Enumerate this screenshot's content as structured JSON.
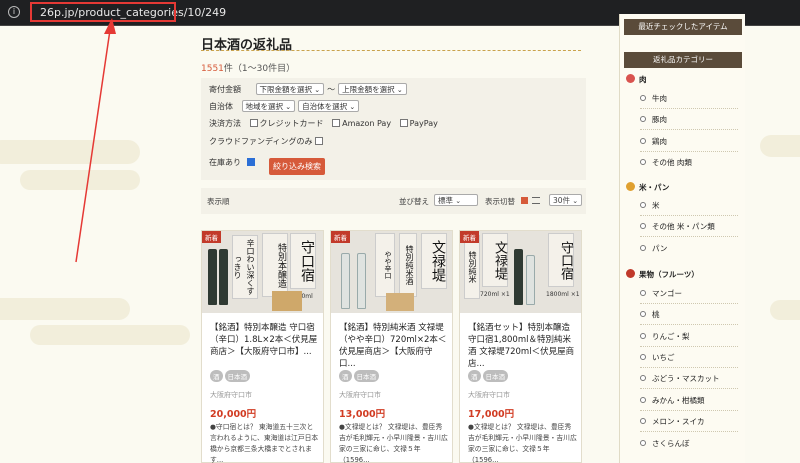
{
  "browser": {
    "url": "26p.jp/product_categories/10/249"
  },
  "main": {
    "title": "日本酒の返礼品",
    "count_num": "1551",
    "count_rest": "件（1～30件目）",
    "filter": {
      "amount_label": "寄付金額",
      "amount_min": "下限金額を選択",
      "tilde": "～",
      "amount_max": "上限金額を選択",
      "region_label": "自治体",
      "region_select": "地域を選択",
      "city_select": "自治体を選択",
      "payment_label": "決済方法",
      "pay_credit": "クレジットカード",
      "pay_amazon": "Amazon Pay",
      "pay_paypay": "PayPay",
      "crowd_label": "クラウドファンディングのみ",
      "stock_label": "在庫あり",
      "search_button": "絞り込み検索"
    },
    "sortbar": {
      "display_order": "表示順",
      "sort_label": "並び替え",
      "sort_value": "標準",
      "view_label": "表示切替",
      "per_page": "30件"
    },
    "cards": [
      {
        "badge": "新着",
        "title": "【銘酒】特別本醸造 守口宿（辛口）1.8L×2本＜伏見屋商店＞【大阪府守口市】...",
        "tags": [
          "酒",
          "日本酒"
        ],
        "location": "大阪府守口市",
        "price": "20,000円",
        "desc": "●守口宿とは？ 東海道五十三次と言われるように、東海道は江戸日本橋から京都三条大橋までとされます..."
      },
      {
        "badge": "新着",
        "title": "【銘酒】特別純米酒 文禄堤（やや辛口）720ml×2本＜伏見屋商店＞【大阪府守口...",
        "tags": [
          "酒",
          "日本酒"
        ],
        "location": "大阪府守口市",
        "price": "13,000円",
        "desc": "●文禄堤とは？ 文禄堤は、豊臣秀吉が毛利輝元・小早川隆景・吉川広家の三家に命じ、文禄５年（1596..."
      },
      {
        "badge": "新着",
        "title": "【銘酒セット】特別本醸造 守口宿1,800ml＆特別純米酒 文禄堤720ml＜伏見屋商店...",
        "tags": [
          "酒",
          "日本酒"
        ],
        "location": "大阪府守口市",
        "price": "17,000円",
        "desc": "●文禄堤とは？ 文禄堤は、豊臣秀吉が毛利輝元・小早川隆景・吉川広家の三家に命じ、文禄５年（1596..."
      }
    ],
    "card_img_text": {
      "a_top": "特別本醸造",
      "a_name": "守口宿",
      "a_side": "辛口わい深くすっきり",
      "a_vol": "1800ml ×2",
      "b_top": "特別純米酒",
      "b_name": "文禄堤",
      "b_side": "やや辛口",
      "c_top": "特別純米",
      "c_name": "文禄堤",
      "c_vol1": "720ml ×1",
      "c_vol2": "1800ml ×1"
    }
  },
  "sidebar": {
    "recent_title": "最近チェックしたアイテム",
    "category_title": "返礼品カテゴリー",
    "categories": [
      {
        "label": "肉",
        "color": "#d9534f",
        "items": [
          "牛肉",
          "豚肉",
          "鶏肉",
          "その他 肉類"
        ]
      },
      {
        "label": "米・パン",
        "color": "#e0a030",
        "items": [
          "米",
          "その他 米・パン類",
          "パン"
        ]
      },
      {
        "label": "果物（フルーツ）",
        "color": "#c0392b",
        "items": [
          "マンゴー",
          "桃",
          "りんご・梨",
          "いちご",
          "ぶどう・マスカット",
          "みかん・柑橘類",
          "メロン・スイカ",
          "さくらんぼ"
        ]
      }
    ]
  },
  "colors": {
    "accent": "#d65a3a",
    "price": "#d13b22",
    "header": "#5a4b3a",
    "annotation": "#e53935"
  }
}
